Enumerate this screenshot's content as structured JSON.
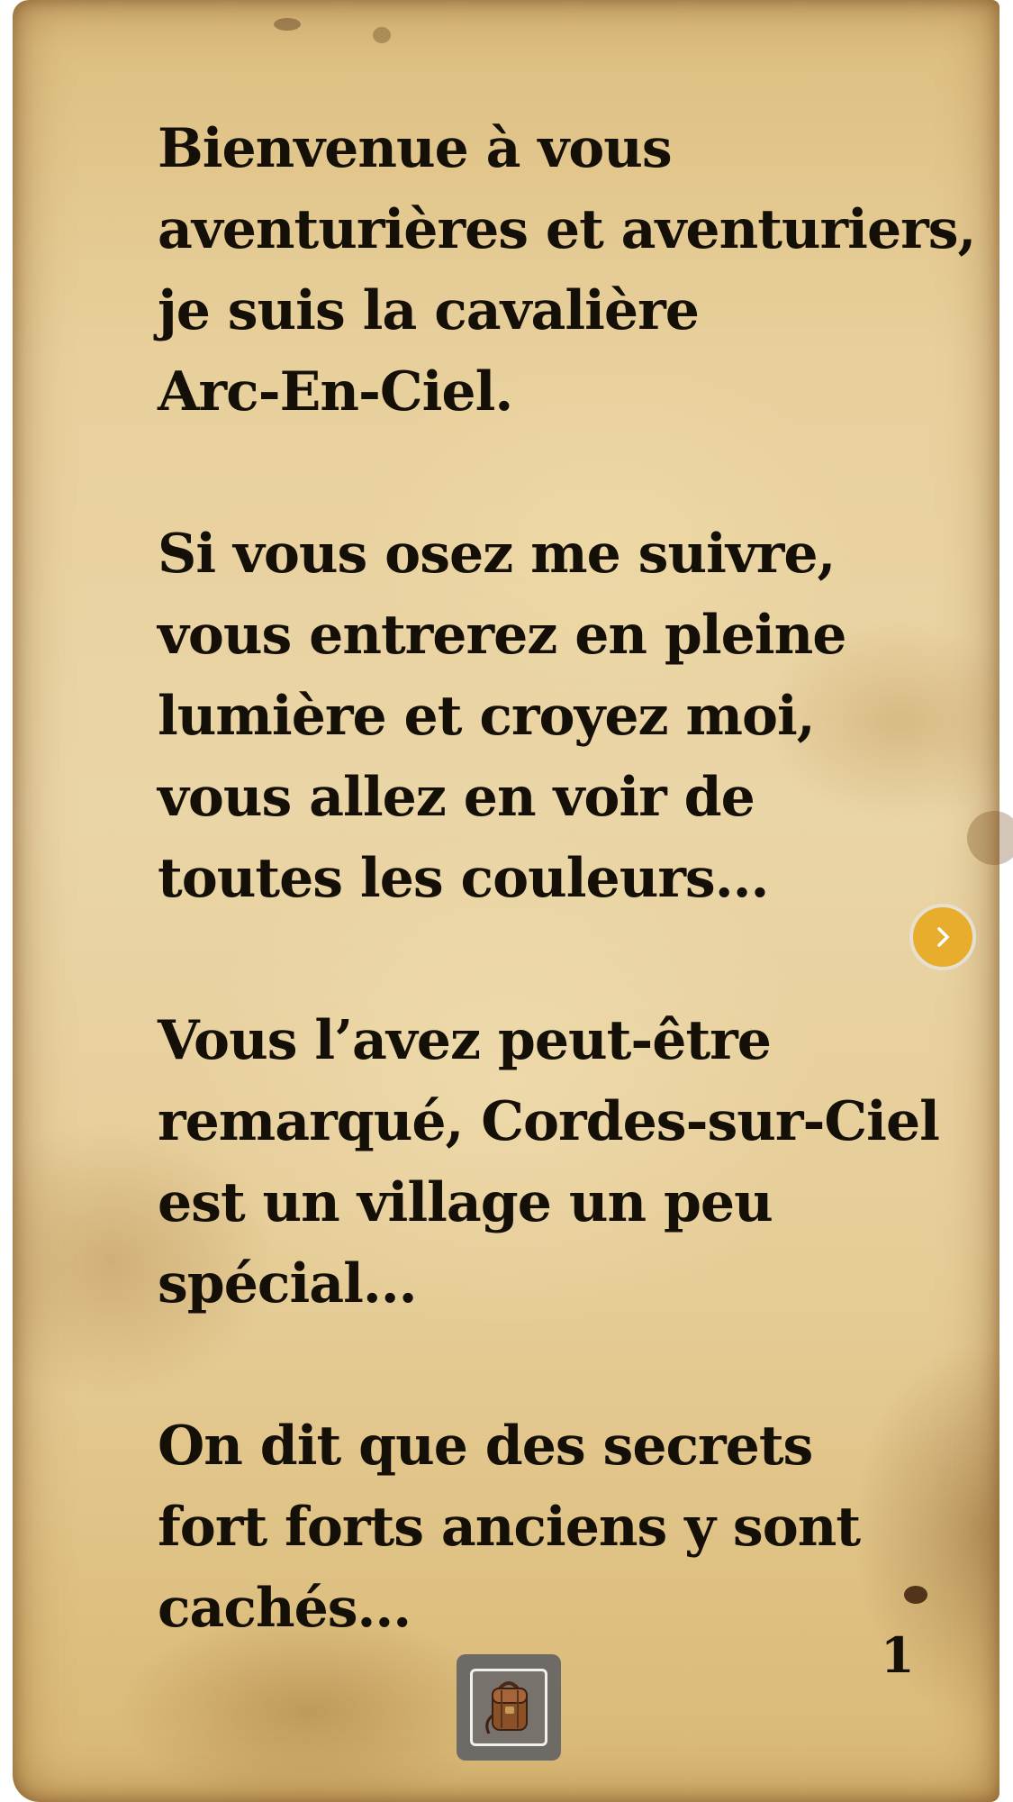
{
  "story": {
    "paragraphs": [
      {
        "lines": [
          "Bienvenue à vous",
          "aventurières et aventuriers,",
          "je suis la cavalière",
          "Arc-En-Ciel."
        ]
      },
      {
        "lines": [
          "Si vous osez me suivre,",
          "vous entrerez en pleine",
          "lumière et croyez moi,",
          "vous allez en voir de",
          "toutes les couleurs..."
        ]
      },
      {
        "lines": [
          "Vous l’avez peut-être",
          "remarqué, Cordes-sur-Ciel",
          "est un village un peu",
          "spécial..."
        ]
      },
      {
        "lines": [
          "On dit que des secrets",
          "fort forts anciens y sont",
          "cachés..."
        ]
      }
    ]
  },
  "page_number": "1",
  "controls": {
    "next_icon": "chevron-right-icon",
    "inventory_icon": "backpack-icon"
  },
  "colors": {
    "parchment": "#e8d09c",
    "text": "#141008",
    "next_button": "#e8ad2c",
    "inventory_button": "#6e6a65"
  }
}
